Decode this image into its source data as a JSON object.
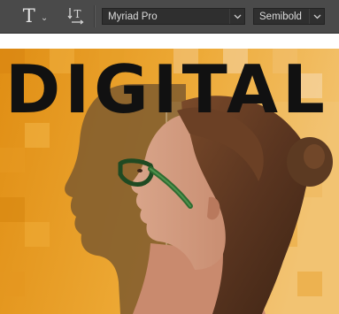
{
  "toolbar": {
    "type_tool_icon": "horizontal-type-icon",
    "type_tool_glyph": "T",
    "orientation_icon": "toggle-text-orientation-icon",
    "font_family": "Myriad Pro",
    "font_style": "Semibold"
  },
  "canvas": {
    "headline": "DIGITAL",
    "colors": {
      "toolbar_bg": "#4a4a4a",
      "field_bg": "#2f2f2f",
      "canvas_orange": "#e49a1c",
      "headline": "#111111"
    }
  }
}
